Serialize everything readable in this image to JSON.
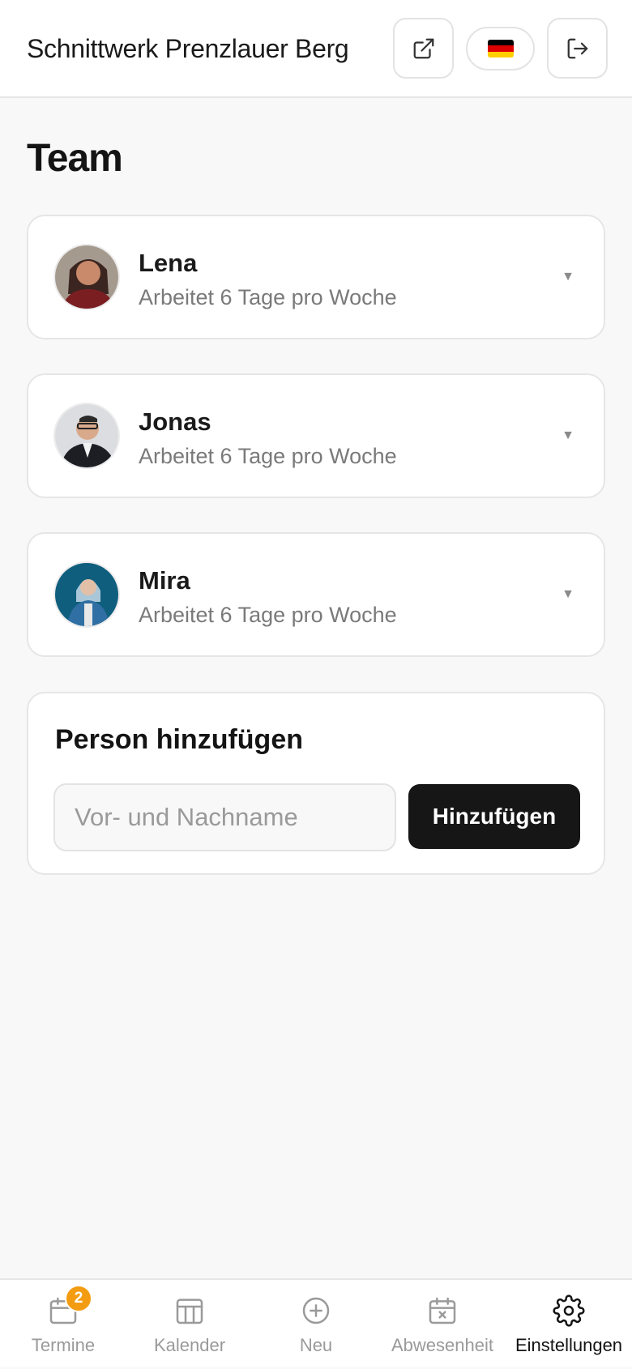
{
  "header": {
    "title": "Schnittwerk Prenzlauer Berg",
    "open_external_icon": "external-link-icon",
    "language_icon": "flag-de-icon",
    "logout_icon": "logout-icon"
  },
  "page": {
    "title": "Team"
  },
  "team": [
    {
      "name": "Lena",
      "subtitle": "Arbeitet 6 Tage pro Woche",
      "avatar_colors": [
        "#7a1e22",
        "#c98a6c",
        "#3b2520"
      ]
    },
    {
      "name": "Jonas",
      "subtitle": "Arbeitet 6 Tage pro Woche",
      "avatar_colors": [
        "#dcdde0",
        "#d9a98c",
        "#1c1e24"
      ]
    },
    {
      "name": "Mira",
      "subtitle": "Arbeitet 6 Tage pro Woche",
      "avatar_colors": [
        "#0f5e7d",
        "#a9c7d8",
        "#2f6fa3"
      ]
    }
  ],
  "add_person": {
    "title": "Person hinzufügen",
    "input_placeholder": "Vor- und Nachname",
    "input_value": "",
    "button_label": "Hinzufügen"
  },
  "nav": {
    "items": [
      {
        "label": "Termine",
        "icon": "calendar-icon",
        "badge": "2",
        "active": false
      },
      {
        "label": "Kalender",
        "icon": "columns-icon",
        "active": false
      },
      {
        "label": "Neu",
        "icon": "plus-circle-icon",
        "active": false
      },
      {
        "label": "Abwesenheit",
        "icon": "calendar-x-icon",
        "active": false
      },
      {
        "label": "Einstellungen",
        "icon": "gear-icon",
        "active": true
      }
    ]
  },
  "colors": {
    "badge": "#f39c12",
    "primary_button": "#161616",
    "flag": [
      "#000000",
      "#dd0000",
      "#ffce00"
    ]
  }
}
